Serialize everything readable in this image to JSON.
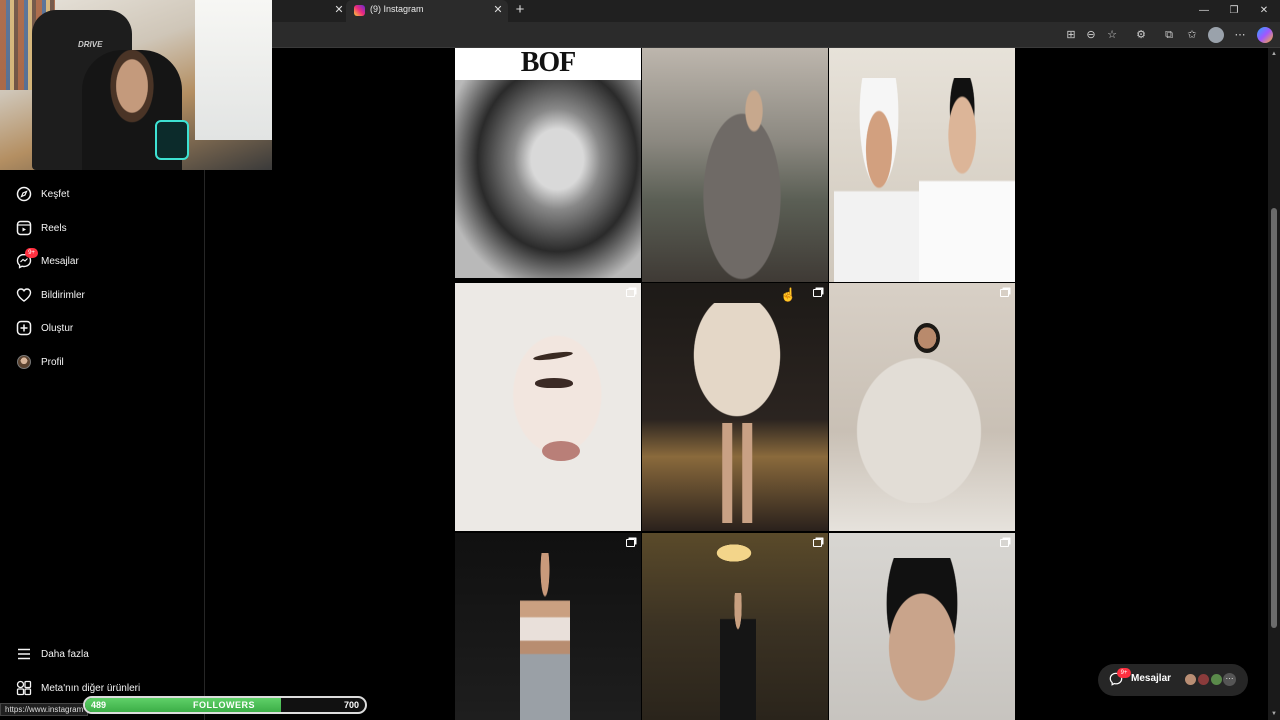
{
  "browser": {
    "tabs": [
      {
        "title": "(9) Instagram",
        "active": true
      }
    ],
    "new_tab_symbol": "+",
    "close_symbol": "✕",
    "window_controls": {
      "minimize": "—",
      "restore": "❐",
      "close": "✕"
    },
    "toolbar_icons": [
      "apps-icon",
      "zoom-icon",
      "favorite-star-icon",
      "extensions-icon",
      "collections-icon",
      "favorites-icon",
      "profile-icon",
      "more-menu-icon",
      "copilot-icon"
    ]
  },
  "webcam": {
    "chair_brand": "DRIVE"
  },
  "sidebar": {
    "items": [
      {
        "label": "Keşfet",
        "icon": "compass-icon"
      },
      {
        "label": "Reels",
        "icon": "reels-icon"
      },
      {
        "label": "Mesajlar",
        "icon": "messenger-icon",
        "badge": "9+"
      },
      {
        "label": "Bildirimler",
        "icon": "heart-icon"
      },
      {
        "label": "Oluştur",
        "icon": "plus-square-icon"
      },
      {
        "label": "Profil",
        "icon": "avatar"
      }
    ],
    "bottom_items": [
      {
        "label": "Daha fazla",
        "icon": "menu-icon"
      },
      {
        "label": "Meta'nın diğer ürünleri",
        "icon": "grid-icon"
      }
    ]
  },
  "status_bar": {
    "url": "https://www.instagram"
  },
  "followers_goal": {
    "current": "489",
    "label": "FOLLOWERS",
    "goal": "700",
    "progress": 0.699
  },
  "grid": {
    "posts": [
      {
        "name": "post-bof-portrait",
        "banner": "BOF",
        "multi": false
      },
      {
        "name": "post-couple",
        "multi": false
      },
      {
        "name": "post-towel-selfie",
        "multi": false
      },
      {
        "name": "post-makeup-illustration",
        "multi": true
      },
      {
        "name": "post-fur-coat-balcony",
        "multi": true
      },
      {
        "name": "post-fur-chair",
        "multi": true
      },
      {
        "name": "post-night-street",
        "multi": true
      },
      {
        "name": "post-palace-interior",
        "multi": true
      },
      {
        "name": "post-closeup-portrait",
        "multi": true
      }
    ]
  },
  "messages_pill": {
    "label": "Mesajlar",
    "badge": "9+",
    "more": "···"
  },
  "colors": {
    "background": "#000000",
    "badge": "#ff3040",
    "progress": "#4cbf55"
  }
}
